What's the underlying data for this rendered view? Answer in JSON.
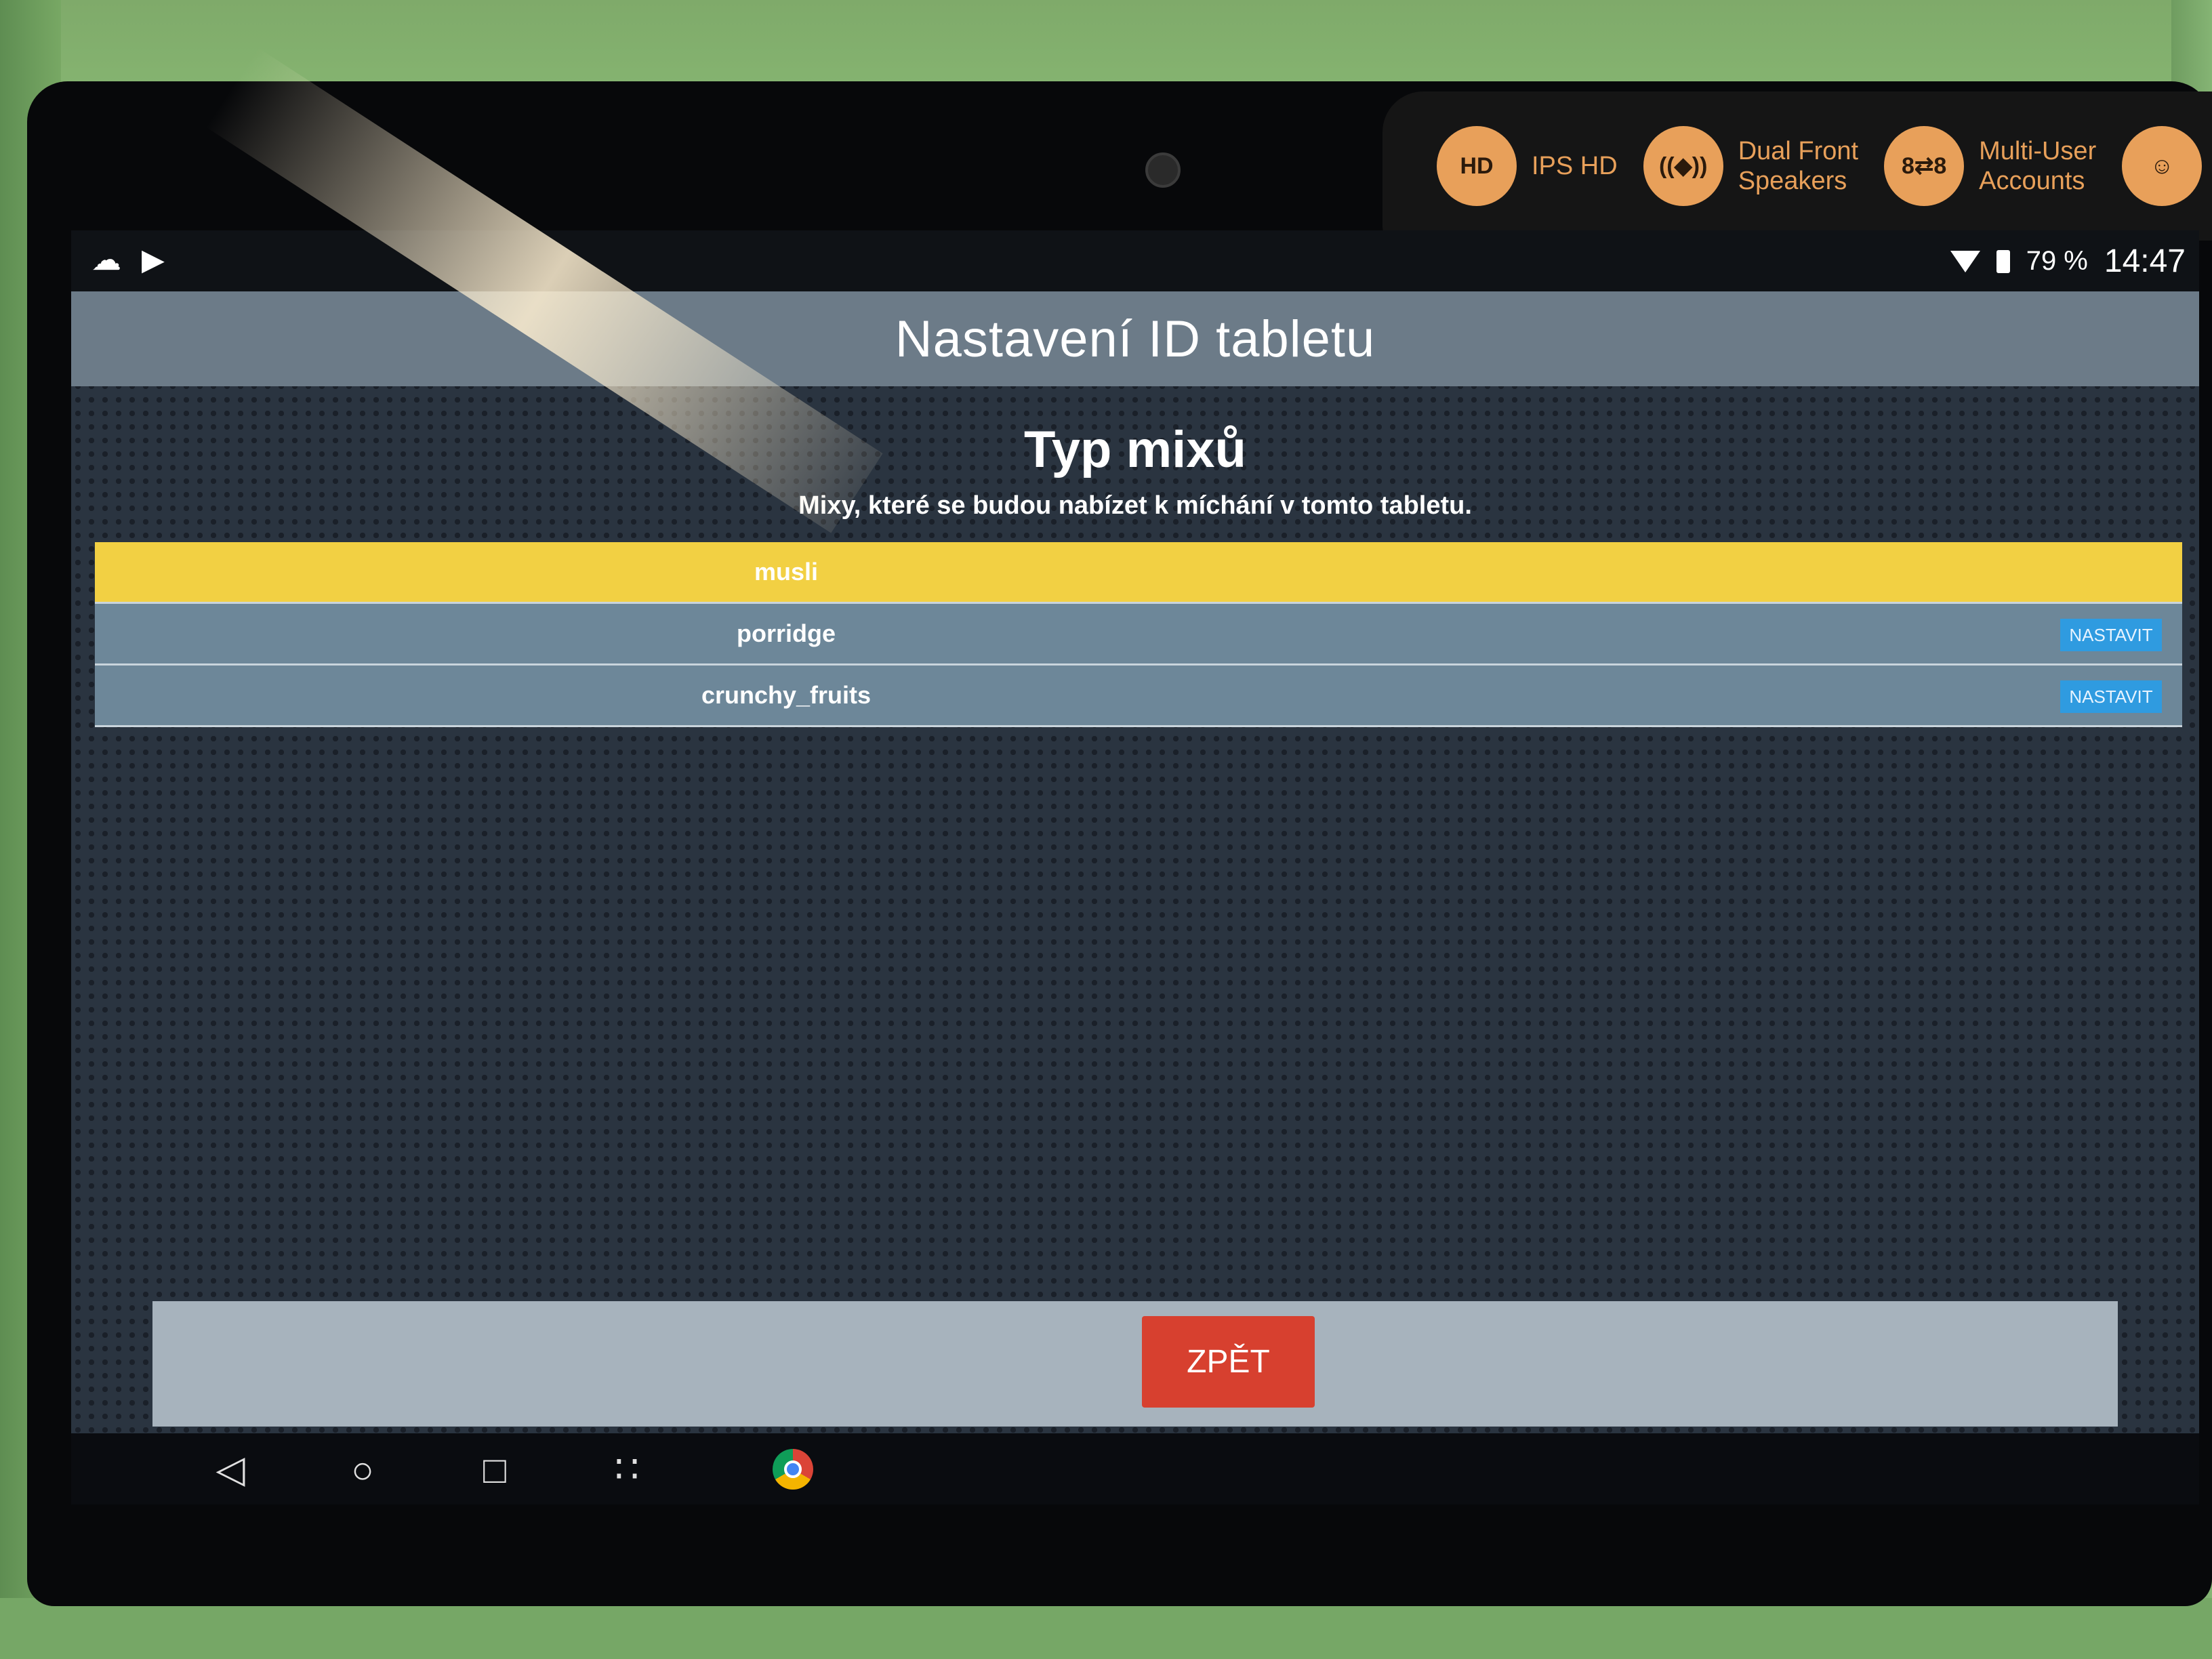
{
  "sticker": {
    "features": [
      {
        "icon": "hd-icon",
        "glyph": "HD",
        "label": "IPS HD"
      },
      {
        "icon": "speaker-icon",
        "glyph": "((◆))",
        "label": "Dual Front\nSpeakers"
      },
      {
        "icon": "multi-user-icon",
        "glyph": "8⇄8",
        "label": "Multi-User\nAccounts"
      },
      {
        "icon": "face-icon",
        "glyph": "☺",
        "label": ""
      }
    ]
  },
  "status_bar": {
    "left_icons": [
      "cloud-icon",
      "play-store-icon"
    ],
    "battery": "79 %",
    "time": "14:47"
  },
  "app": {
    "title": "Nastavení ID tabletu",
    "section_title": "Typ mixů",
    "section_subtitle": "Mixy, které se budou nabízet k míchání v tomto tabletu.",
    "mixes": [
      {
        "name": "musli",
        "selected": true,
        "button": ""
      },
      {
        "name": "porridge",
        "selected": false,
        "button": "NASTAVIT"
      },
      {
        "name": "crunchy_fruits",
        "selected": false,
        "button": "NASTAVIT"
      }
    ],
    "back_button": "ZPĚT"
  },
  "nav_bar": {
    "items": [
      "back-icon",
      "home-icon",
      "recents-icon",
      "apps-icon",
      "chrome-icon"
    ],
    "glyphs": {
      "back": "◁",
      "home": "○",
      "recents": "□",
      "apps": "∷"
    }
  }
}
